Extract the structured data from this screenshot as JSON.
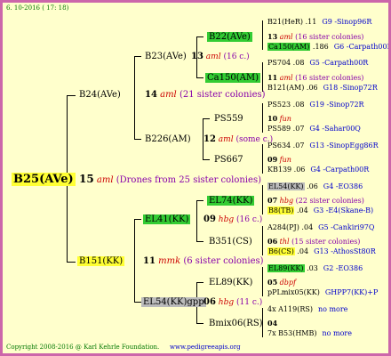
{
  "header": {
    "date": "6. 10-2016 ( 17: 18)"
  },
  "footer": {
    "copyright": "Copyright 2008-2016 @ Karl Kehrle Foundation.",
    "website": "www.pedigreeapis.org"
  },
  "root": {
    "name": "B25(AVe)",
    "gen": "15",
    "mark": "aml",
    "note": "(Drones from 25 sister colonies)",
    "color": "#ffff33"
  },
  "g1": [
    {
      "name": "B24(AVe)",
      "gen": "14",
      "mark": "aml",
      "note": "(21 sister colonies)"
    },
    {
      "name": "B151(KK)",
      "gen": "11",
      "mark": "mmk",
      "note": "(6 sister colonies)",
      "color": "#ffff33"
    }
  ],
  "g2": [
    {
      "name": "B23(AVe)",
      "gen": "13",
      "mark": "aml",
      "note": "(16 c.)"
    },
    {
      "name": "B226(AM)",
      "gen": "12",
      "mark": "aml",
      "note": "(some c.)"
    },
    {
      "name": "EL41(KK)",
      "gen": "09",
      "mark": "hbg",
      "note": "(16 c.)",
      "color": "#33cc33"
    },
    {
      "name": "EL54(KK)gpp",
      "gen": "06",
      "mark": "hbg",
      "note": "(11 c.)",
      "color": "#bbbbbb"
    }
  ],
  "g3": [
    {
      "name": "B22(AVe)",
      "color": "#33cc33"
    },
    {
      "name": "Ca150(AM)",
      "color": "#33cc33"
    },
    {
      "name": "PS559"
    },
    {
      "name": "PS667"
    },
    {
      "name": "EL74(KK)",
      "color": "#33cc33"
    },
    {
      "name": "B351(CS)"
    },
    {
      "name": "EL89(KK)"
    },
    {
      "name": "Bmix06(RS)"
    }
  ],
  "g4": [
    {
      "name": "B21(HeR)",
      "val": ".11",
      "ref": "G9 -Sinop96R"
    },
    {
      "name": "13",
      "mark": "aml",
      "note": "(16 sister colonies)"
    },
    {
      "name": "Ca150(AM)",
      "val": ".186",
      "ref": "G6 -Carpath00R",
      "color": "#33cc33"
    },
    {
      "name": "PS704",
      "val": ".08",
      "ref": "G5 -Carpath00R"
    },
    {
      "name": "11",
      "mark": "aml",
      "note": "(16 sister colonies)"
    },
    {
      "name": "B121(AM)",
      "val": ".06",
      "ref": "G18 -Sinop72R"
    },
    {
      "name": "PS523",
      "val": ".08",
      "ref": "G19 -Sinop72R"
    },
    {
      "name": "10",
      "mark": "fun"
    },
    {
      "name": "PS589",
      "val": ".07",
      "ref": "G4 -Sahar00Q"
    },
    {
      "name": "PS634",
      "val": ".07",
      "ref": "G13 -SinopEgg86R"
    },
    {
      "name": "09",
      "mark": "fun"
    },
    {
      "name": "KB139",
      "val": ".06",
      "ref": "G4 -Carpath00R"
    },
    {
      "name": "EL54(KK)",
      "val": ".06",
      "ref": "G4 -EO386",
      "color": "#bbbbbb"
    },
    {
      "name": "07",
      "mark": "hbg",
      "note": "(22 sister colonies)"
    },
    {
      "name": "B8(TB)",
      "val": ".04",
      "ref": "G3 -E4(Skane-B)",
      "color": "#ffff33"
    },
    {
      "name": "A284(PJ)",
      "val": ".04",
      "ref": "G5 -Cankiri97Q"
    },
    {
      "name": "06",
      "mark": "thl",
      "note": "(15 sister colonies)"
    },
    {
      "name": "B6(CS)",
      "val": ".04",
      "ref": "G13 -AthosSt80R",
      "color": "#ffff33"
    },
    {
      "name": "EL89(KK)",
      "val": ".03",
      "ref": "G2 -EO386",
      "color": "#33cc33"
    },
    {
      "name": "05",
      "mark": "dbpf"
    },
    {
      "name": "pPLmix05(KK)",
      "val": "",
      "ref": "GHPP7(KK)+P"
    },
    {
      "name": "4x A119(RS)",
      "val": "",
      "ref": "no more"
    },
    {
      "name": "04",
      "mark": ""
    },
    {
      "name": "7x B53(HMB)",
      "val": "",
      "ref": "no more"
    }
  ]
}
